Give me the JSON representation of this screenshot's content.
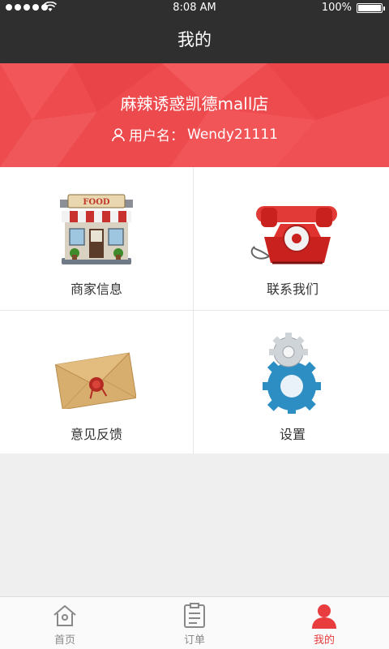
{
  "status_bar": {
    "time": "8:08 AM",
    "battery": "100%"
  },
  "nav": {
    "title": "我的"
  },
  "profile": {
    "shop_name": "麻辣诱惑凯德mall店",
    "username_label": "用户名：",
    "username": "Wendy21111"
  },
  "menu": [
    {
      "label": "商家信息",
      "icon": "storefront-icon"
    },
    {
      "label": "联系我们",
      "icon": "telephone-icon"
    },
    {
      "label": "意见反馈",
      "icon": "envelope-icon"
    },
    {
      "label": "设置",
      "icon": "gear-icon"
    }
  ],
  "store_sign": "FOOD",
  "tabs": [
    {
      "label": "首页",
      "icon": "home-icon"
    },
    {
      "label": "订单",
      "icon": "order-list-icon"
    },
    {
      "label": "我的",
      "icon": "user-icon"
    }
  ],
  "colors": {
    "accent": "#e83c3f",
    "banner": "#ee4b4e",
    "navbar": "#2f2f2f"
  }
}
